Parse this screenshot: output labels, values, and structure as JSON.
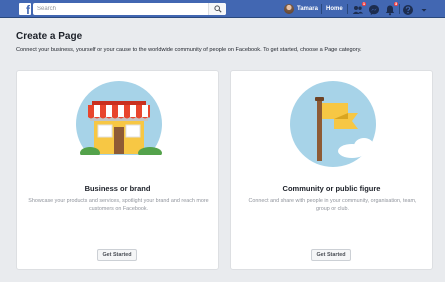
{
  "topbar": {
    "search_placeholder": "Search",
    "user_name": "Tamara",
    "home_label": "Home",
    "friend_requests_count": "1",
    "notifications_count": "3"
  },
  "page": {
    "title": "Create a Page",
    "subtitle": "Connect your business, yourself or your cause to the worldwide community of people on Facebook. To get started, choose a Page category."
  },
  "cards": [
    {
      "title": "Business or brand",
      "description": "Showcase your products and services, spotlight your brand and reach more customers on Facebook.",
      "button": "Get Started",
      "icon": "storefront-icon"
    },
    {
      "title": "Community or public figure",
      "description": "Connect and share with people in your community, organisation, team, group or club.",
      "button": "Get Started",
      "icon": "flag-icon"
    }
  ],
  "colors": {
    "brand_blue": "#4267b2",
    "background": "#e9ebee",
    "illustration_sky": "#a7d3e8",
    "awning_red": "#e8452d",
    "flag_yellow": "#f7c744"
  }
}
